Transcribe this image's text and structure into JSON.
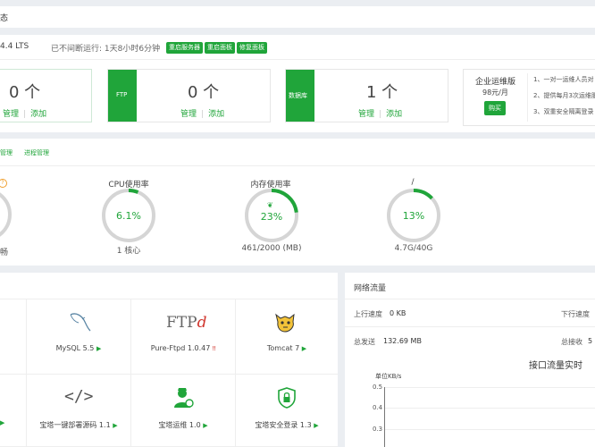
{
  "header": {
    "title_fragment": "态"
  },
  "system": {
    "os_fragment": "4.4 LTS",
    "uptime": "已不间断运行: 1天8小时6分钟",
    "buttons": [
      "重启服务器",
      "重启面板",
      "修复面板"
    ]
  },
  "stats": [
    {
      "label": "",
      "value": "0 个",
      "actions": [
        "管理",
        "添加"
      ]
    },
    {
      "label": "FTP",
      "value": "0 个",
      "actions": [
        "管理",
        "添加"
      ]
    },
    {
      "label": "数据库",
      "value": "1 个",
      "actions": [
        "管理",
        "添加"
      ]
    }
  ],
  "promo": {
    "title": "企业运维版",
    "price": "98元/月",
    "buy": "购买",
    "features": [
      "1、一对一运维人员对",
      "2、提供每月3次运维服",
      "3、双重安全隔离登录"
    ]
  },
  "tabs": [
    "管理",
    "进程管理"
  ],
  "gauges": [
    {
      "title": "",
      "value": "",
      "sub": "",
      "percent": 0
    },
    {
      "title": "CPU使用率",
      "value": "6.1%",
      "sub": "1 核心",
      "percent": 6.1
    },
    {
      "title": "内存使用率",
      "value": "23%",
      "sub": "461/2000 (MB)",
      "percent": 23
    },
    {
      "title": "/",
      "value": "13%",
      "sub": "4.7G/40G",
      "percent": 13
    }
  ],
  "software": [
    {
      "name": "MySQL 5.5",
      "flag": "▶",
      "icon": "mysql-icon"
    },
    {
      "name": "Pure-Ftpd 1.0.47",
      "flag": "‼",
      "icon": "ftp-icon"
    },
    {
      "name": "Tomcat 7",
      "flag": "▶",
      "icon": "tomcat-icon"
    },
    {
      "name": "宝塔一键部署源码 1.1",
      "flag": "▶",
      "icon": "code-icon"
    },
    {
      "name": "宝塔运维 1.0",
      "flag": "▶",
      "icon": "ops-icon"
    },
    {
      "name": "宝塔安全登录 1.3",
      "flag": "▶",
      "icon": "shield-lock-icon"
    }
  ],
  "network": {
    "title": "网络流量",
    "up_label": "上行速度",
    "up_value": "0 KB",
    "down_label": "下行速度",
    "sent_label": "总发送",
    "sent_value": "132.69 MB",
    "recv_label": "总接收",
    "recv_value": "5",
    "chart_title": "接口流量实时",
    "unit": "单位KB/s",
    "yticks": [
      "0.5",
      "0.4",
      "0.3"
    ]
  },
  "colors": {
    "accent": "#20a53a",
    "gauge_track": "#d5d5d5"
  }
}
